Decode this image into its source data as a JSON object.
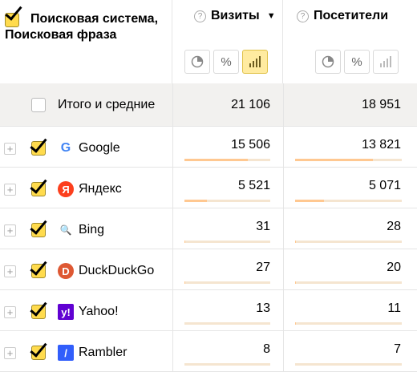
{
  "header": {
    "name_col_line1": "Поисковая система,",
    "name_col_line2": "Поисковая фраза",
    "visits_label": "Визиты",
    "visitors_label": "Посетители",
    "help_icon": "?",
    "sort_icon": "▼"
  },
  "total": {
    "label": "Итого и средние",
    "visits": "21 106",
    "visitors": "18 951"
  },
  "rows": [
    {
      "label": "Google",
      "icon": "google-icon",
      "logo_text": "G",
      "logo_color": "#ffffff",
      "visits": "15 506",
      "visitors": "13 821",
      "visits_share": 0.735,
      "visitors_share": 0.729
    },
    {
      "label": "Яндекс",
      "icon": "yandex-icon",
      "logo_text": "Я",
      "logo_color": "#fc3f1d",
      "visits": "5 521",
      "visitors": "5 071",
      "visits_share": 0.262,
      "visitors_share": 0.268
    },
    {
      "label": "Bing",
      "icon": "bing-icon",
      "logo_text": "🔍",
      "logo_color": "#ffffff",
      "visits": "31",
      "visitors": "28",
      "visits_share": 0.0015,
      "visitors_share": 0.0015
    },
    {
      "label": "DuckDuckGo",
      "icon": "duckduckgo-icon",
      "logo_text": "D",
      "logo_color": "#de5833",
      "visits": "27",
      "visitors": "20",
      "visits_share": 0.0013,
      "visitors_share": 0.0011
    },
    {
      "label": "Yahoo!",
      "icon": "yahoo-icon",
      "logo_text": "y!",
      "logo_color": "#6001d2",
      "visits": "13",
      "visitors": "11",
      "visits_share": 0.0006,
      "visitors_share": 0.0006
    },
    {
      "label": "Rambler",
      "icon": "rambler-icon",
      "logo_text": "/",
      "logo_color": "#315efb",
      "visits": "8",
      "visitors": "7",
      "visits_share": 0.0004,
      "visitors_share": 0.0004
    }
  ],
  "colors": {
    "accent": "#ffdb4d",
    "bar_track": "#f5e5d0",
    "bar_fill": "#ffc891"
  }
}
